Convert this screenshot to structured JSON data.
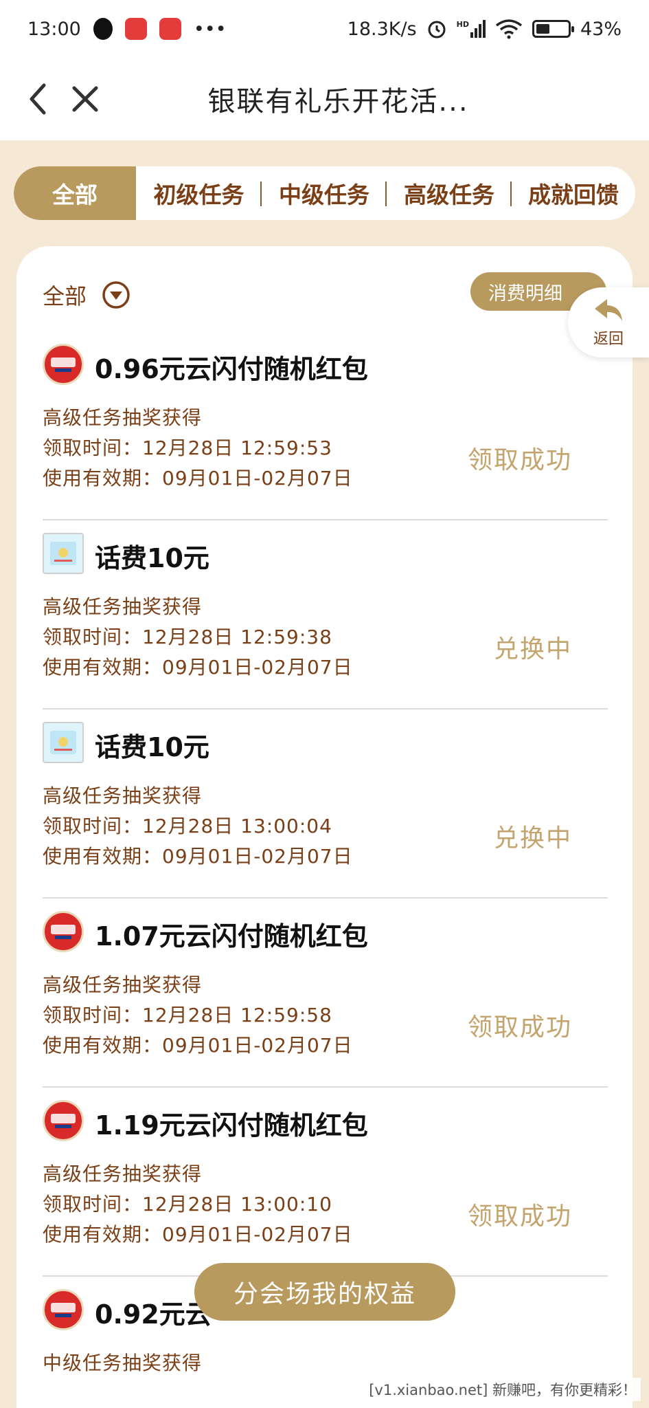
{
  "status_bar": {
    "time": "13:00",
    "more": "•••",
    "net_speed": "18.3K/s",
    "hd": "HD",
    "battery": "43%",
    "battery_level": 0.43
  },
  "nav": {
    "title": "银联有礼乐开花活..."
  },
  "tabs": [
    "全部",
    "初级任务",
    "中级任务",
    "高级任务",
    "成就回馈"
  ],
  "filter": {
    "label": "全部"
  },
  "detail_button": "消费明细",
  "back_float": "返回",
  "items": [
    {
      "icon": "redpack-icon",
      "title": "0.96元云闪付随机红包",
      "source": "高级任务抽奖获得",
      "time": "领取时间：12月28日 12:59:53",
      "validity": "使用有效期：09月01日-02月07日",
      "status": "领取成功"
    },
    {
      "icon": "phone-credit-icon",
      "title": "话费10元",
      "source": "高级任务抽奖获得",
      "time": "领取时间：12月28日 12:59:38",
      "validity": "使用有效期：09月01日-02月07日",
      "status": "兑换中"
    },
    {
      "icon": "phone-credit-icon",
      "title": "话费10元",
      "source": "高级任务抽奖获得",
      "time": "领取时间：12月28日 13:00:04",
      "validity": "使用有效期：09月01日-02月07日",
      "status": "兑换中"
    },
    {
      "icon": "redpack-icon",
      "title": "1.07元云闪付随机红包",
      "source": "高级任务抽奖获得",
      "time": "领取时间：12月28日 12:59:58",
      "validity": "使用有效期：09月01日-02月07日",
      "status": "领取成功"
    },
    {
      "icon": "redpack-icon",
      "title": "1.19元云闪付随机红包",
      "source": "高级任务抽奖获得",
      "time": "领取时间：12月28日 13:00:10",
      "validity": "使用有效期：09月01日-02月07日",
      "status": "领取成功"
    },
    {
      "icon": "redpack-icon",
      "title": "0.92元云",
      "source": "中级任务抽奖获得"
    }
  ],
  "float_button": "分会场我的权益",
  "watermark": "[v1.xianbao.net] 新赚吧，有你更精彩！",
  "colors": {
    "accent": "#b99a5e",
    "brown_text": "#7a3f16",
    "status_text": "#c4a46d",
    "page_bg": "#f5e9d6"
  }
}
